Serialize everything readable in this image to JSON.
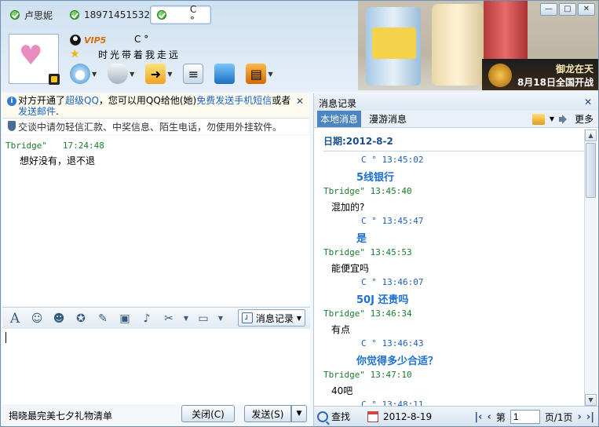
{
  "tabs": [
    {
      "label": "卢思妮"
    },
    {
      "label": "18971451532"
    },
    {
      "label": "C °"
    }
  ],
  "window_buttons": {
    "min": "—",
    "max": "□",
    "close": "✕"
  },
  "banner": {
    "ad_line1": "御龙在天",
    "ad_line2": "8月18日全国开战"
  },
  "profile": {
    "vip": "VIP5",
    "nickname": "C °",
    "signature": "时光带着我走远"
  },
  "toolbar_icons": [
    "camera-icon",
    "mic-icon",
    "file-transfer-icon",
    "chat-add-icon",
    "remote-assist-icon",
    "apps-icon"
  ],
  "notice": {
    "part1": "对方开通了",
    "link1": "超级QQ",
    "part2": "，您可以用QQ给他(她)",
    "link2": "免费发送手机短信",
    "part3": "或者",
    "link3": "发送邮件",
    "part4": "."
  },
  "security_notice": "交谈中请勿轻信汇款、中奖信息、陌生电话，勿使用外挂软件。",
  "chat": {
    "messages": [
      {
        "sender": "Tbridge\"",
        "time": "17:24:48",
        "text": "想好没有，退不退"
      }
    ]
  },
  "input_toolbar": {
    "history_label": "消息记录"
  },
  "bottom": {
    "ad_text": "揭晓最完美七夕礼物清单",
    "close_label": "关闭(C)",
    "send_label": "发送(S)",
    "send_arrow": "▼"
  },
  "history_panel": {
    "title": "消息记录",
    "tab_local": "本地消息",
    "tab_roam": "漫游消息",
    "more": "更多",
    "date": "日期:2012-8-2",
    "entries": [
      {
        "who": "self",
        "head": "C °    13:45:02",
        "text": "5线银行"
      },
      {
        "who": "peer",
        "head": "Tbridge\" 13:45:40",
        "text": "混加的?"
      },
      {
        "who": "self",
        "head": "C °    13:45:47",
        "text": "是"
      },
      {
        "who": "peer",
        "head": "Tbridge\" 13:45:53",
        "text": "能便宜吗"
      },
      {
        "who": "self",
        "head": "C °    13:46:07",
        "text": "50J  还贵吗"
      },
      {
        "who": "peer",
        "head": "Tbridge\" 13:46:34",
        "text": "有点"
      },
      {
        "who": "self",
        "head": "C °    13:46:43",
        "text": "你觉得多少合适？"
      },
      {
        "who": "peer",
        "head": "Tbridge\" 13:47:10",
        "text": "40吧"
      },
      {
        "who": "self",
        "head": "C °    13:48:11",
        "text": ""
      }
    ],
    "search_label": "查找",
    "bottom_date": "2012-8-19",
    "page_label": "第",
    "page_value": "1",
    "page_total": "页/1页"
  }
}
